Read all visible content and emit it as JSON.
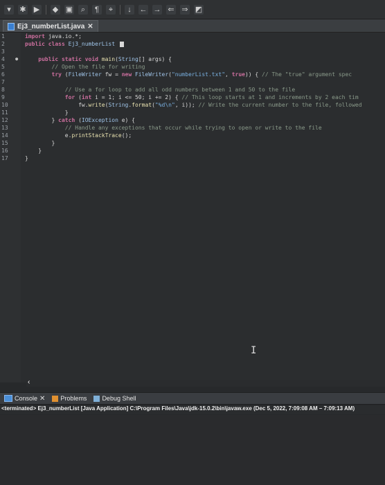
{
  "editor": {
    "tab_label": "Ej3_numberList.java",
    "tab_close": "✕",
    "lines": [
      {
        "n": "1",
        "fold": "",
        "html": "<span class='kw'>import</span> java.io.*;"
      },
      {
        "n": "2",
        "fold": "",
        "html": "<span class='kw'>public class</span> <span class='ty'>Ej3_numberList</span> <span class='cursor-box'></span>"
      },
      {
        "n": "3",
        "fold": "",
        "html": ""
      },
      {
        "n": "4",
        "fold": "●",
        "html": "    <span class='kw'>public static void</span> <span class='fn'>main</span>(<span class='ty'>String</span>[] args) {"
      },
      {
        "n": "5",
        "fold": "",
        "html": "        <span class='cm'>// Open the file for writing</span>"
      },
      {
        "n": "6",
        "fold": "",
        "html": "        <span class='kw'>try</span> (<span class='ty'>FileWriter</span> fw = <span class='kw'>new</span> <span class='ty'>FileWriter</span>(<span class='st'>\"numberList.txt\"</span>, <span class='kw'>true</span>)) { <span class='cm'>// The \"true\" argument spec</span>"
      },
      {
        "n": "7",
        "fold": "",
        "html": ""
      },
      {
        "n": "8",
        "fold": "",
        "html": "            <span class='cm'>// Use a for loop to add all odd numbers between 1 and 50 to the file</span>"
      },
      {
        "n": "9",
        "fold": "",
        "html": "            <span class='kw'>for</span> (<span class='kw'>int</span> i = 1; i &lt;= 50; i += 2) { <span class='cm'>// This loop starts at 1 and increments by 2 each tim</span>"
      },
      {
        "n": "10",
        "fold": "",
        "html": "                fw.<span class='fn'>write</span>(<span class='ty'>String</span>.<span class='fn'>format</span>(<span class='st'>\"%d\\n\"</span>, i)); <span class='cm'>// Write the current number to the file, followed</span>"
      },
      {
        "n": "11",
        "fold": "",
        "html": "            }"
      },
      {
        "n": "12",
        "fold": "",
        "html": "        } <span class='kw'>catch</span> (<span class='ty'>IOException</span> e) {"
      },
      {
        "n": "13",
        "fold": "",
        "html": "            <span class='cm'>// Handle any exceptions that occur while trying to open or write to the file</span>"
      },
      {
        "n": "14",
        "fold": "",
        "html": "            e.<span class='fn'>printStackTrace</span>();"
      },
      {
        "n": "15",
        "fold": "",
        "html": "        }"
      },
      {
        "n": "16",
        "fold": "",
        "html": "    }"
      },
      {
        "n": "17",
        "fold": "",
        "html": "}"
      }
    ]
  },
  "console": {
    "tabs": [
      {
        "label": "Console",
        "close": "✕"
      },
      {
        "label": "Problems",
        "close": ""
      },
      {
        "label": "Debug Shell",
        "close": ""
      }
    ],
    "status": "<terminated> Ej3_numberList [Java Application] C:\\Program Files\\Java\\jdk-15.0.2\\bin\\javaw.exe (Dec 5, 2022, 7:09:08 AM – 7:09:13 AM)"
  },
  "icons": {
    "java_file": "java-file-icon",
    "console": "console-icon",
    "problems": "problems-icon",
    "debug_shell": "debug-shell-icon"
  },
  "colors": {
    "background": "#2b2d2f",
    "keyword": "#cc6f9e",
    "comment": "#8a9a8a",
    "string": "#79b0e0"
  }
}
